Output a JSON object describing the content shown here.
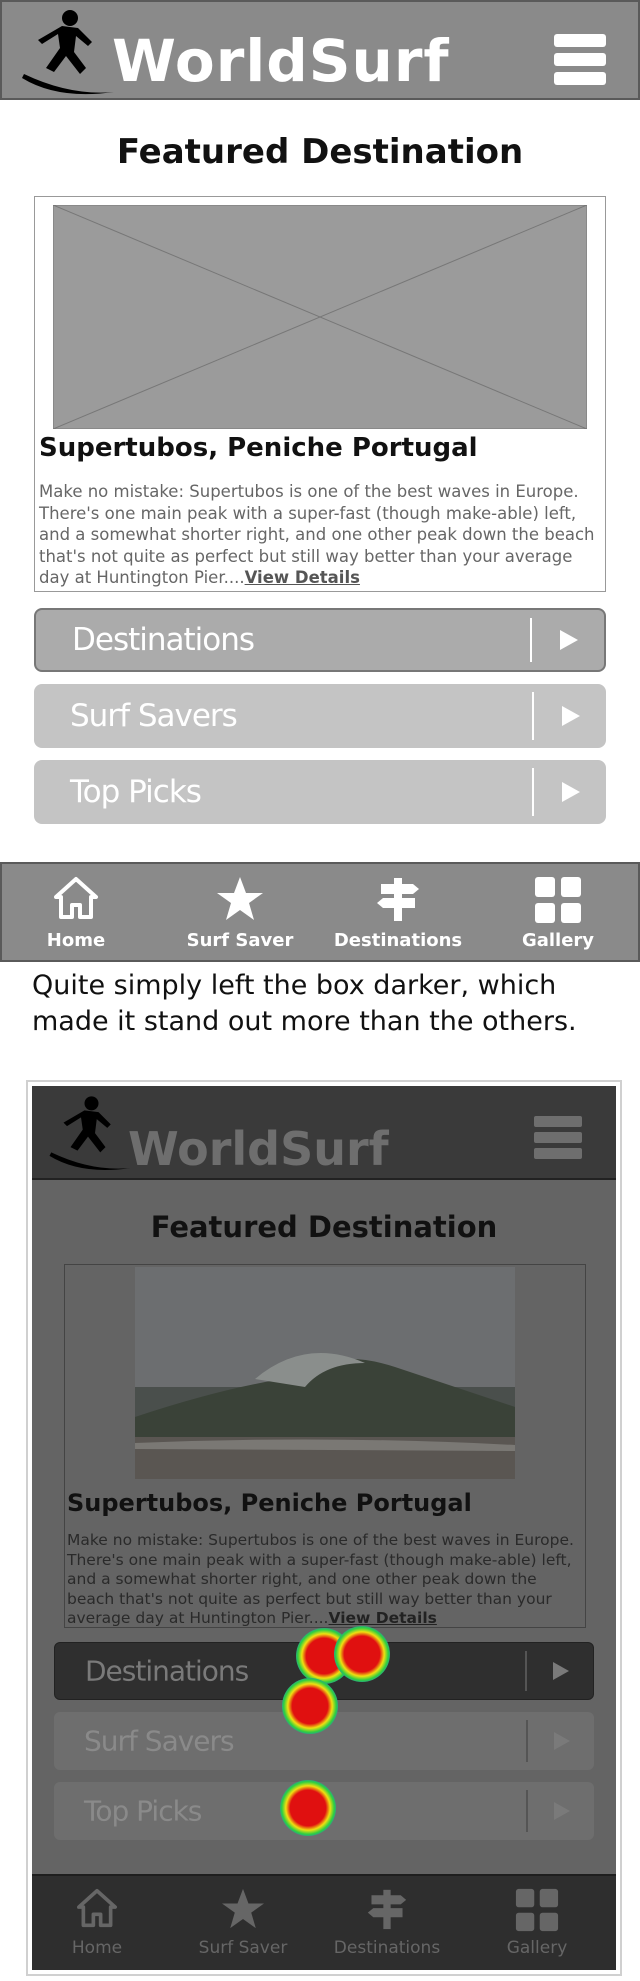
{
  "brand": {
    "name": "WorldSurf"
  },
  "featured": {
    "heading": "Featured Destination",
    "title": "Supertubos, Peniche Portugal",
    "description": "Make no mistake: Supertubos is one of the best waves in Europe. There's one main peak with a super-fast (though make-able) left, and a somewhat shorter right, and one other peak down the beach that's not quite as perfect but still way better than your average day at Huntington Pier....",
    "link": "View Details"
  },
  "accordion": [
    {
      "label": "Destinations"
    },
    {
      "label": "Surf Savers"
    },
    {
      "label": "Top Picks"
    }
  ],
  "nav": [
    {
      "label": "Home",
      "icon": "home-icon"
    },
    {
      "label": "Surf Saver",
      "icon": "star-icon"
    },
    {
      "label": "Destinations",
      "icon": "signpost-icon"
    },
    {
      "label": "Gallery",
      "icon": "grid-icon"
    }
  ],
  "caption": "Quite simply left the box darker, which made it stand out more than the others.",
  "colors": {
    "header_bg": "#8a8a8a",
    "accordion_bg": "#c4c4c4",
    "accordion_active_bg": "#ababab",
    "heat_core": "#e01010"
  }
}
